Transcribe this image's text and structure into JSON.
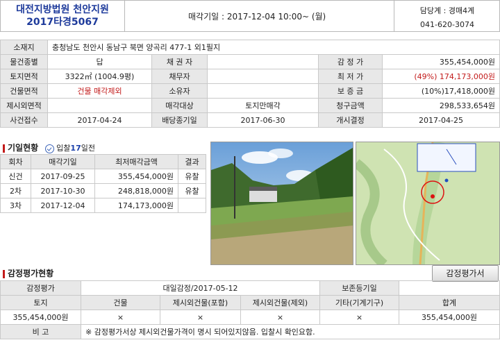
{
  "header": {
    "court_name": "대전지방법원 천안지원",
    "case_number": "2017타경5067",
    "sale_date_label": "매각기일 : 2017-12-04 10:00~ (월)",
    "dept_label": "담당계 : 경매4계",
    "dept_phone": "041-620-3074"
  },
  "info": {
    "address_label": "소재지",
    "address": "충청남도 천안시 동남구 북면 양곡리 477-1 외1필지",
    "type_label": "물건종별",
    "type": "답",
    "creditor_label": "채 권 자",
    "creditor": "",
    "appraisal_label": "감 정 가",
    "appraisal": "355,454,000원",
    "land_area_label": "토지면적",
    "land_area": "3322㎡ (1004.9평)",
    "debtor_label": "채무자",
    "debtor": "",
    "min_price_label": "최 저 가",
    "min_price": "(49%) 174,173,000원",
    "bldg_area_label": "건물면적",
    "bldg_area": "건물 매각제외",
    "owner_label": "소유자",
    "owner": "",
    "deposit_label": "보 증 금",
    "deposit": "(10%)17,418,000원",
    "excluded_label": "제시외면적",
    "excluded": "",
    "target_label": "매각대상",
    "target": "토지만매각",
    "claim_label": "청구금액",
    "claim": "298,533,654원",
    "received_label": "사건접수",
    "received": "2017-04-24",
    "deadline_label": "배당종기일",
    "deadline": "2017-06-30",
    "start_label": "개시결정",
    "start": "2017-04-25"
  },
  "history": {
    "title": "기일현황",
    "clock_icon": "clock-check-icon",
    "bid_note_prefix": "입찰",
    "bid_note_days": "17",
    "bid_note_suffix": "일전",
    "columns": [
      "회차",
      "매각기일",
      "최저매각금액",
      "결과"
    ],
    "rows": [
      {
        "round": "신건",
        "date": "2017-09-25",
        "price": "355,454,000원",
        "result": "유찰"
      },
      {
        "round": "2차",
        "date": "2017-10-30",
        "price": "248,818,000원",
        "result": "유찰"
      },
      {
        "round": "3차",
        "date": "2017-12-04",
        "price": "174,173,000원",
        "result": ""
      }
    ]
  },
  "appraisal": {
    "title": "감정평가현황",
    "button_label": "감정평가서",
    "row1": {
      "label": "감정평가",
      "value": "대일감정/2017-05-12",
      "label2": "보존등기일",
      "value2": ""
    },
    "columns": [
      "토지",
      "건물",
      "제시외건물(포함)",
      "제시외건물(제외)",
      "기타(기계기구)",
      "합계"
    ],
    "values": [
      "355,454,000원",
      "×",
      "×",
      "×",
      "×",
      "355,454,000원"
    ],
    "note_label": "비 고",
    "note": "※ 감정평가서상 제시외건물가격이 명시 되어있지않음. 입찰시 확인요함."
  },
  "colors": {
    "title_blue": "#1d3a9b",
    "accent_red": "#c21a1a",
    "label_bg": "#e8e8e8"
  }
}
